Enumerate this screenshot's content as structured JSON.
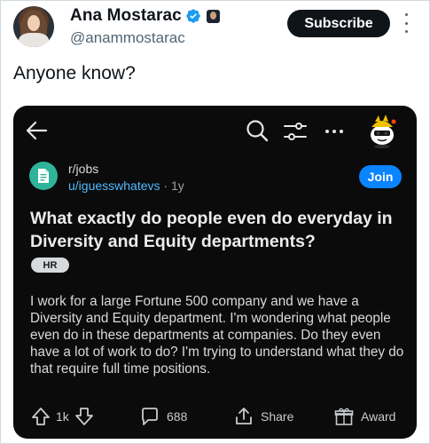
{
  "author": {
    "display_name": "Ana Mostarac",
    "handle": "@anammostarac"
  },
  "subscribe_label": "Subscribe",
  "tweet_text": "Anyone know?",
  "reddit_post": {
    "subreddit": "r/jobs",
    "username": "u/iguesswhatevs",
    "age": "1y",
    "join_label": "Join",
    "title": "What exactly do people even do everyday in Diversity and Equity departments?",
    "flair": "HR",
    "body": "I work for a large Fortune 500 company and we have a Diversity and Equity department. I'm wondering what people even do in these departments at companies. Do they even have a lot of work to do? I'm trying to understand what they do that require full time positions.",
    "votes": "1k",
    "comments": "688",
    "share_label": "Share",
    "award_label": "Award"
  },
  "colors": {
    "verified_badge": "#1d9bf0",
    "card_background": "#0b0b0c",
    "join_button": "#0a84ff",
    "username_link": "#4fbcff",
    "subscribe_button": "#0f1419"
  },
  "icons": [
    "verified-badge-icon",
    "back-arrow-icon",
    "search-icon",
    "filter-icon",
    "more-icon",
    "snoo-avatar-icon",
    "subreddit-icon",
    "upvote-icon",
    "downvote-icon",
    "comment-icon",
    "share-icon",
    "award-icon"
  ]
}
